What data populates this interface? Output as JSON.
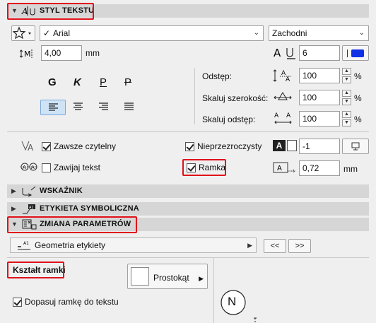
{
  "sections": {
    "text_style": {
      "title": "STYL TEKSTU"
    },
    "pointer": {
      "title": "WSKAŹNIK"
    },
    "symbol_label": {
      "title": "ETYKIETA SYMBOLICZNA"
    },
    "param_change": {
      "title": "ZMIANA PARAMETRÓW"
    }
  },
  "font": {
    "name": "Arial",
    "script": "Zachodni"
  },
  "size": {
    "value": "4,00",
    "unit": "mm"
  },
  "pen": {
    "value": "6",
    "color": "#1230e6"
  },
  "styles": {
    "bold": "G",
    "italic": "K",
    "underline": "P",
    "strike": "P"
  },
  "spacing": {
    "line_spacing": {
      "label": "Odstęp:",
      "value": "100",
      "unit": "%"
    },
    "width_scale": {
      "label": "Skaluj szerokość:",
      "value": "100",
      "unit": "%"
    },
    "char_spacing": {
      "label": "Skaluj odstęp:",
      "value": "100",
      "unit": "%"
    }
  },
  "options": {
    "always_readable": {
      "label": "Zawsze czytelny",
      "checked": true
    },
    "wrap_text": {
      "label": "Zawijaj tekst",
      "checked": false
    },
    "opaque": {
      "label": "Nieprzezroczysty",
      "checked": true
    },
    "frame": {
      "label": "Ramka",
      "checked": true
    }
  },
  "background_pen": {
    "value": "-1"
  },
  "frame_offset": {
    "value": "0,72",
    "unit": "mm"
  },
  "param_panel": {
    "dropdown": "Geometria etykiety",
    "prev": "<<",
    "next": ">>",
    "frame_shape_label": "Kształt ramki",
    "shape_value": "Prostokąt",
    "fit_frame": {
      "label": "Dopasuj ramkę do tekstu",
      "checked": true
    },
    "preview_letter": "N"
  },
  "colors": {
    "accent_red": "#e0101a",
    "pen_blue": "#1230e6",
    "header_gray": "#d6d6d6"
  }
}
